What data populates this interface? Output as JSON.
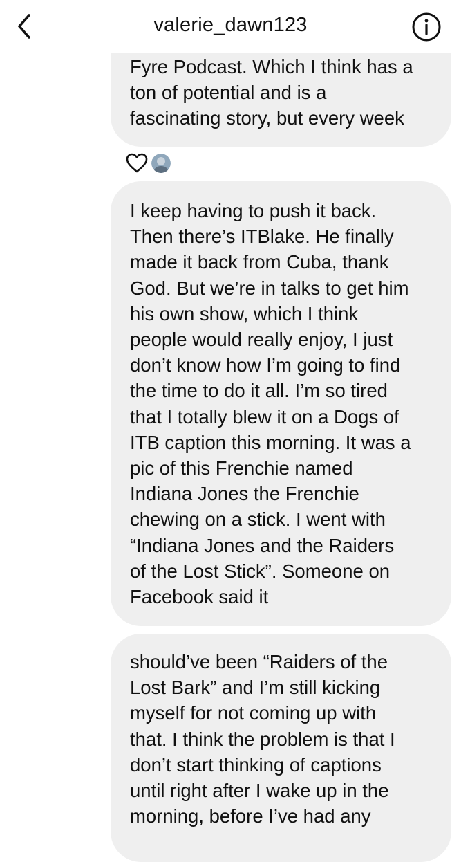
{
  "header": {
    "title": "valerie_dawn123",
    "back_icon": "chevron-left-icon",
    "info_icon": "info-circle-icon"
  },
  "messages": [
    {
      "lines": [
        "Fyre Podcast. Which I think has a",
        "ton of potential and is a",
        "fascinating story, but every week"
      ]
    },
    {
      "lines": [
        "I keep having to push it back.",
        "Then there’s ITBlake. He finally",
        "made it back from Cuba, thank",
        "God. But we’re in talks to get him",
        "his own show, which I think",
        "people would really enjoy, I just",
        "don’t know how I’m going to find",
        "the time to do it all. I’m so tired",
        "that I totally blew it on a Dogs of",
        "ITB caption this morning. It was a",
        "pic of this Frenchie named",
        "Indiana Jones the Frenchie",
        "chewing on a stick. I went with",
        "“Indiana Jones and the Raiders",
        "of the Lost Stick”. Someone on",
        "Facebook said it"
      ]
    },
    {
      "lines": [
        "should’ve been “Raiders of the",
        "Lost Bark” and I’m still kicking",
        "myself for not coming up with",
        "that. I think the problem is that I",
        "don’t start thinking of captions",
        "until right after I wake up in the",
        "morning, before I’ve had any"
      ]
    }
  ],
  "reaction": {
    "icon": "heart-outline-icon",
    "reactor_avatar": "avatar"
  },
  "colors": {
    "bubble": "#efefef",
    "text": "#111111",
    "divider": "#dbdbdb"
  }
}
